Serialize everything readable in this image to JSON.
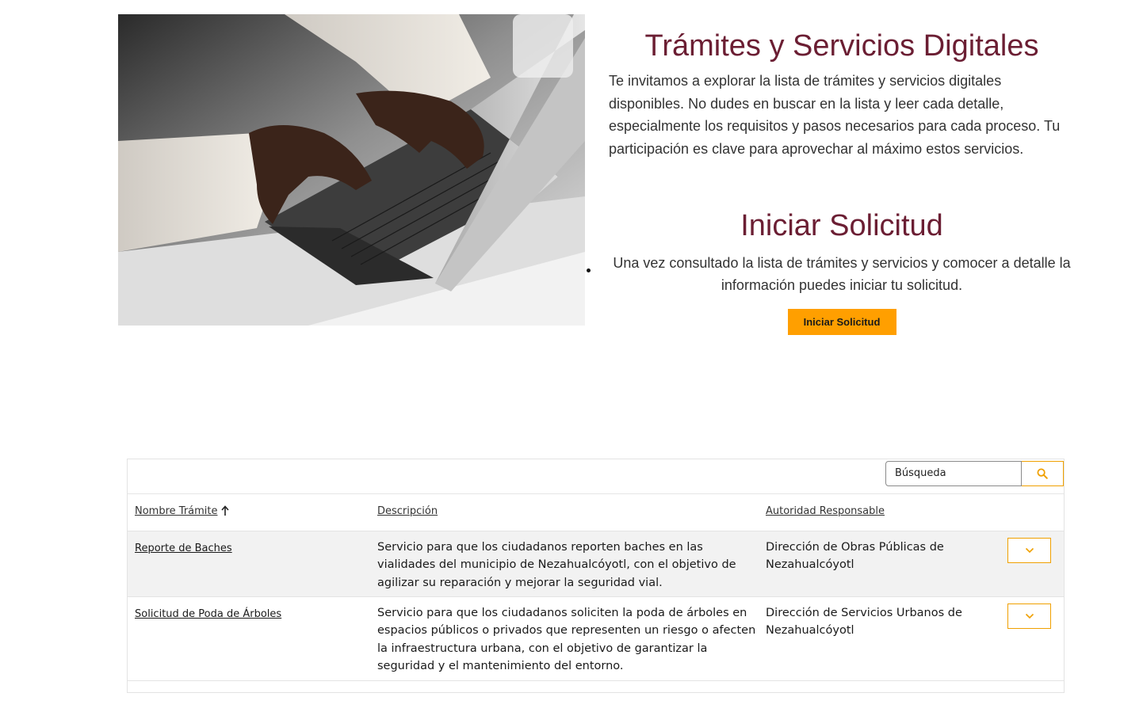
{
  "intro": {
    "title": "Trámites y Servicios Digitales",
    "text": "Te invitamos a explorar la lista de trámites y servicios digitales disponibles. No dudes en buscar en la lista y leer cada detalle, especialmente los requisitos y pasos necesarios para cada proceso. Tu participación es clave para aprovechar al máximo estos servicios."
  },
  "start": {
    "title": "Iniciar Solicitud",
    "text": "Una vez consultado la lista de trámites y servicios y comocer a detalle la información puedes iniciar tu solicitud.",
    "button_label": "Iniciar Solicitud"
  },
  "search": {
    "placeholder": "Búsqueda",
    "icon": "search-icon"
  },
  "table": {
    "headers": {
      "name": "Nombre Trámite",
      "description": "Descripción",
      "authority": "Autoridad Responsable"
    },
    "sort_icon": "arrow-up-icon",
    "rows": [
      {
        "name": "Reporte de Baches",
        "description": "Servicio para que los ciudadanos reporten baches en las vialidades del municipio de Nezahualcóyotl, con el objetivo de agilizar su reparación y mejorar la seguridad vial.",
        "authority": "Dirección de Obras Públicas de Nezahualcóyotl"
      },
      {
        "name": "Solicitud de Poda de Árboles",
        "description": "Servicio para que los ciudadanos soliciten la poda de árboles en espacios públicos o privados que representen un riesgo o afecten la infraestructura urbana, con el objetivo de garantizar la seguridad y el mantenimiento del entorno.",
        "authority": "Dirección de Servicios Urbanos de Nezahualcóyotl"
      }
    ],
    "expand_icon": "chevron-down-icon"
  },
  "colors": {
    "accent": "#ff9f00",
    "heading": "#6b1e33"
  }
}
